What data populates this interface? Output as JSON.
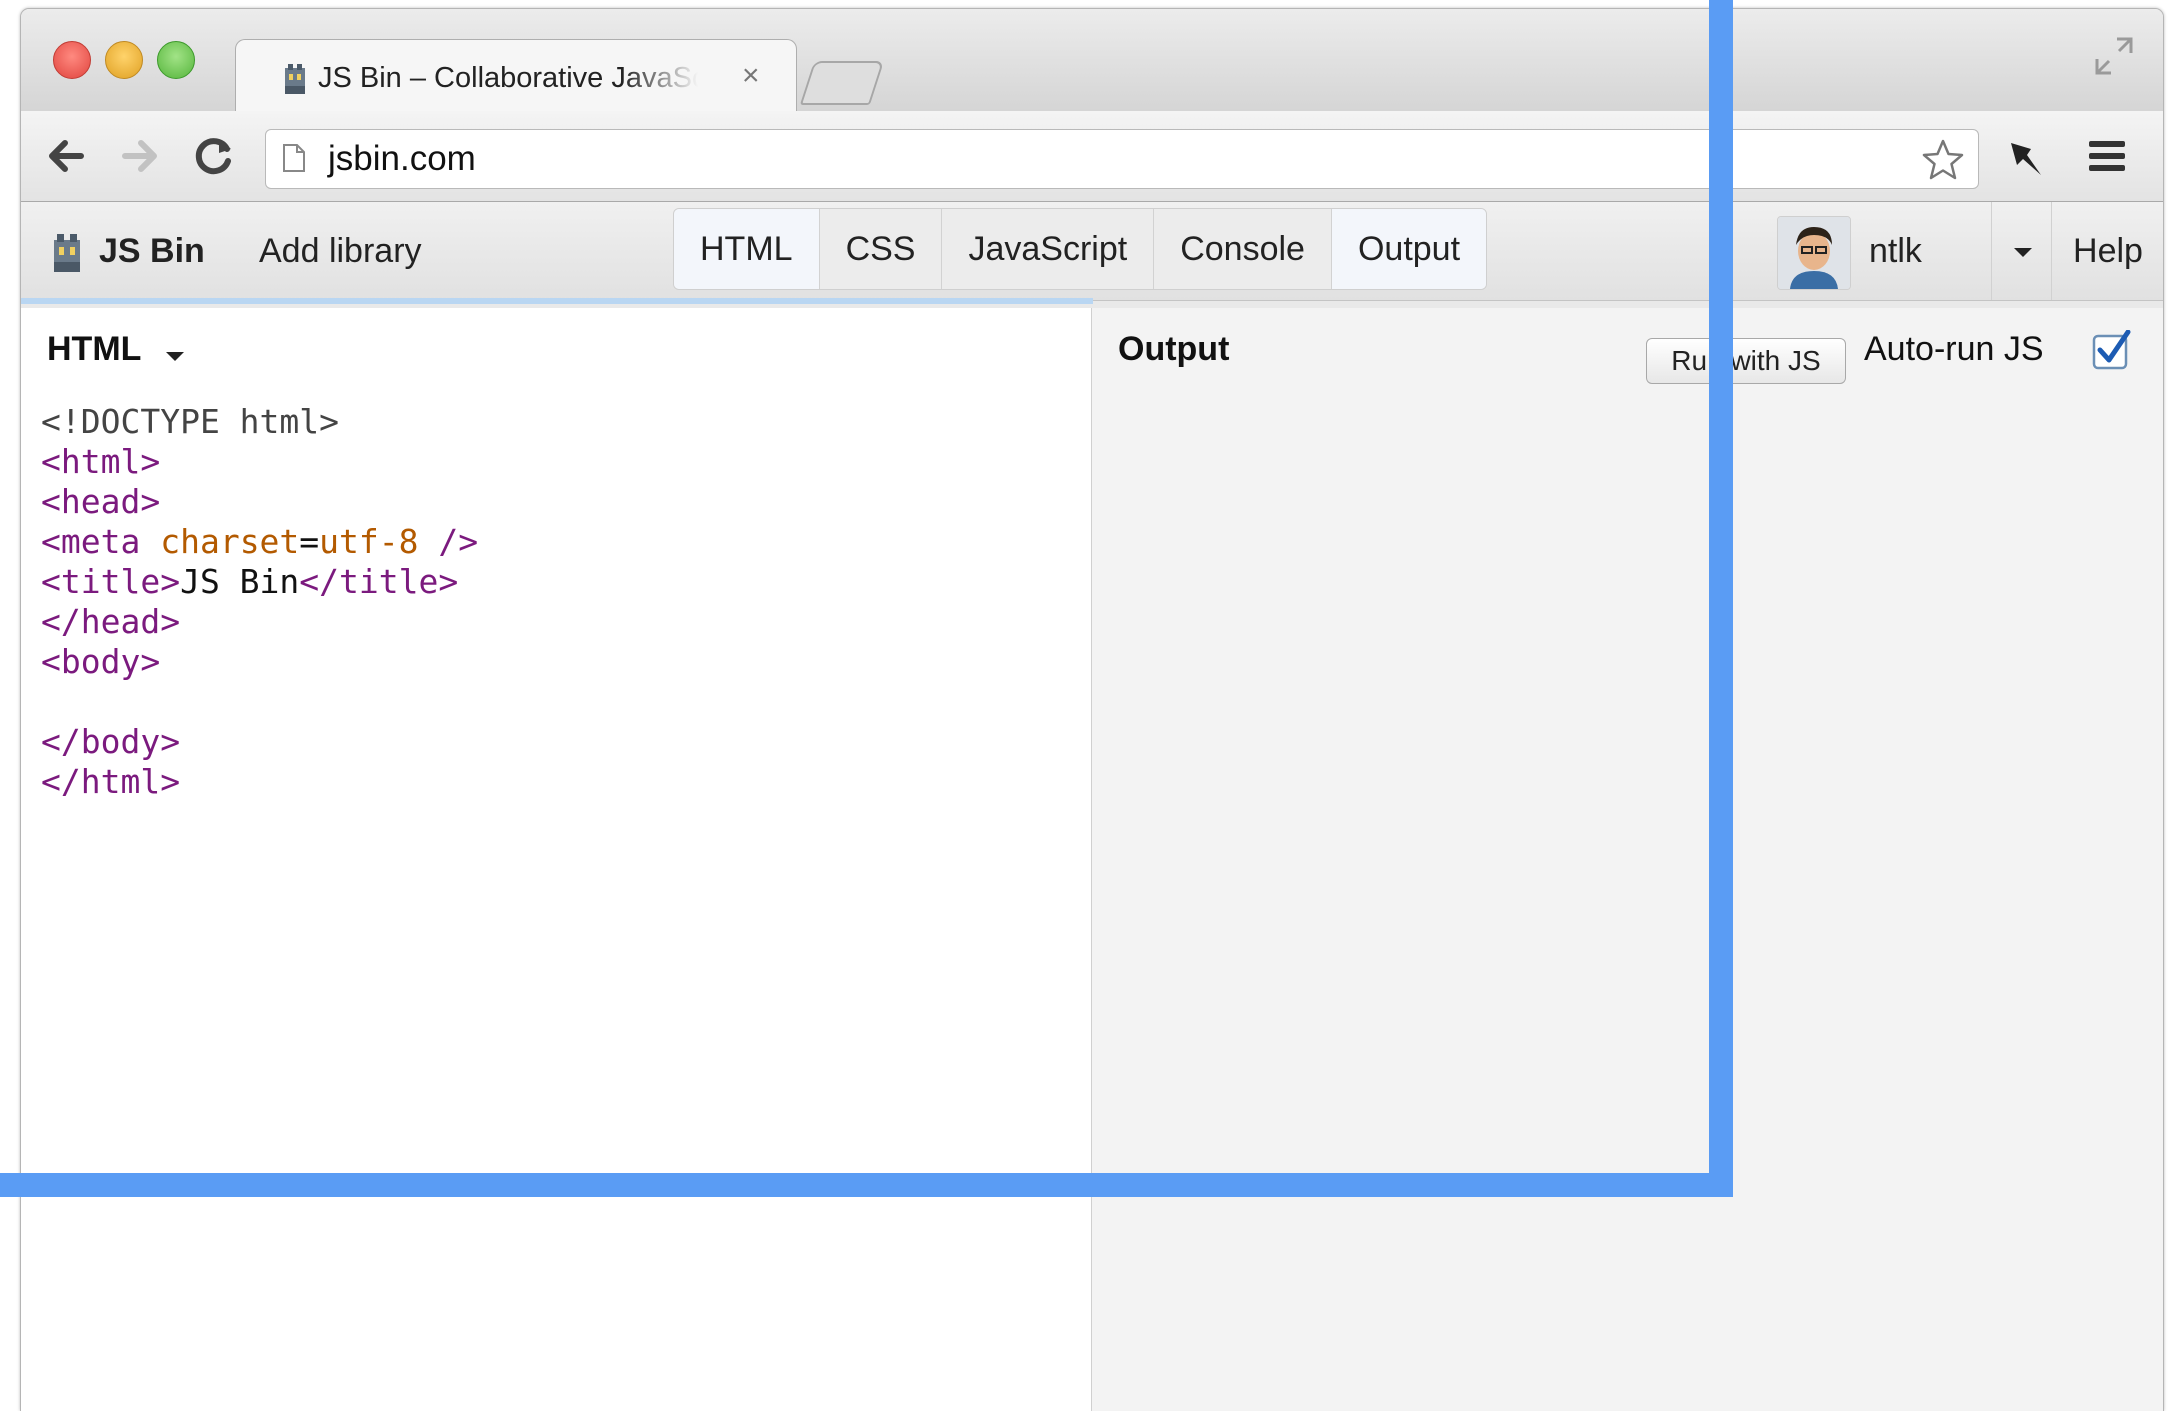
{
  "browser": {
    "tab": {
      "title": "JS Bin – Collaborative JavaScr",
      "close_glyph": "×"
    },
    "address": {
      "url": "jsbin.com"
    }
  },
  "jsbin": {
    "brand": "JS Bin",
    "add_library": "Add library",
    "panels": [
      {
        "label": "HTML",
        "active": true
      },
      {
        "label": "CSS",
        "active": false
      },
      {
        "label": "JavaScript",
        "active": false
      },
      {
        "label": "Console",
        "active": false
      },
      {
        "label": "Output",
        "active": true
      }
    ],
    "user": {
      "name": "ntlk"
    },
    "help": "Help"
  },
  "editor": {
    "label": "HTML",
    "code_lines": [
      "<!DOCTYPE html>",
      "<html>",
      "<head>",
      "<meta charset=utf-8 />",
      "<title>JS Bin</title>",
      "</head>",
      "<body>",
      "",
      "</body>",
      "</html>"
    ]
  },
  "output": {
    "label": "Output",
    "run_button": "Run with JS",
    "autorun_label": "Auto-run JS",
    "autorun_checked": true
  },
  "colors": {
    "overlay_frame": "#5a9cf4",
    "code_tag": "#7b1a7e",
    "code_attr": "#b35a00",
    "active_panel": "#f3f6fb"
  },
  "icons": [
    "close-icon",
    "fullscreen-icon",
    "back-icon",
    "forward-icon",
    "reload-icon",
    "page-icon",
    "star-icon",
    "pin-icon",
    "menu-icon",
    "jsbin-logo-icon",
    "chevron-down-icon",
    "checkbox-checked-icon"
  ]
}
